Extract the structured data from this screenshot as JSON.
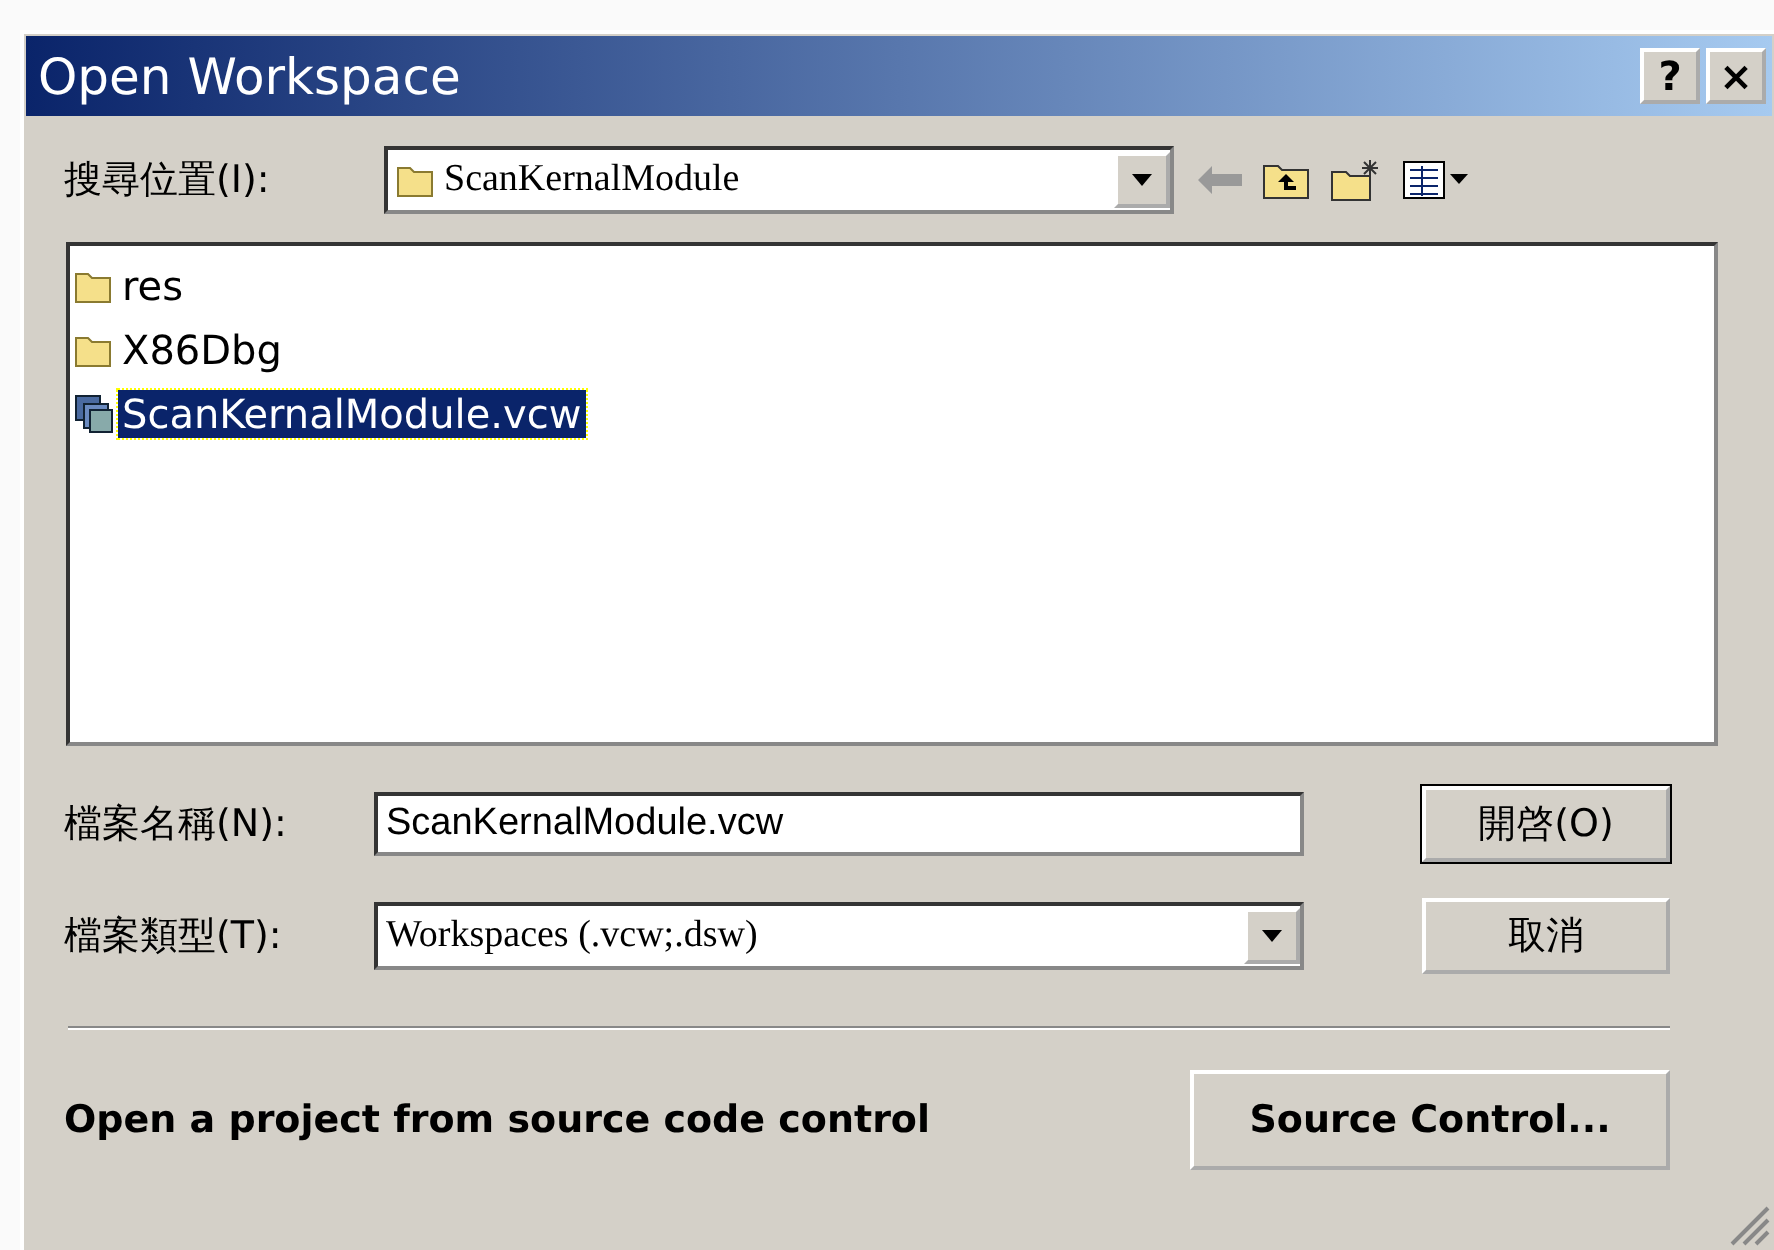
{
  "window": {
    "title": "Open Workspace",
    "buttons": [
      "?",
      "×"
    ]
  },
  "look_in": {
    "label": "搜尋位置(I):",
    "value": "ScanKernalModule"
  },
  "files": [
    {
      "name": "res",
      "kind": "folder",
      "selected": false
    },
    {
      "name": "X86Dbg",
      "kind": "folder",
      "selected": false
    },
    {
      "name": "ScanKernalModule.vcw",
      "kind": "workspace",
      "selected": true
    }
  ],
  "file_name": {
    "label": "檔案名稱(N):",
    "value": "ScanKernalModule.vcw"
  },
  "file_type": {
    "label": "檔案類型(T):",
    "value": "Workspaces (.vcw;.dsw)"
  },
  "buttons": [
    "開啓(O)",
    "取消"
  ],
  "source_control": {
    "text": "Open a project from source code control",
    "button": "Source Control..."
  }
}
